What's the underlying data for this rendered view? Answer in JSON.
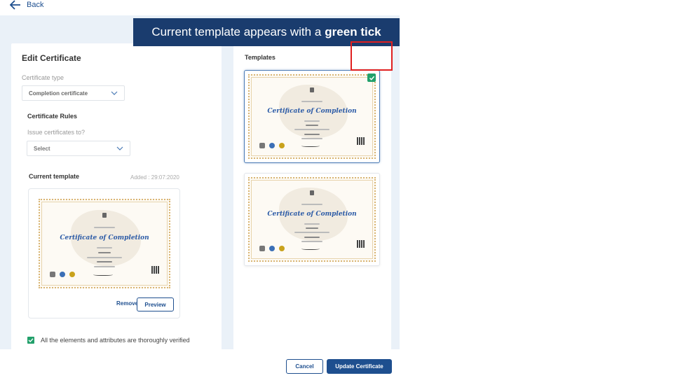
{
  "nav": {
    "back_label": "Back"
  },
  "banner": {
    "text": "Current template appears with a",
    "emphasis": "green tick"
  },
  "edit": {
    "title": "Edit Certificate",
    "type_label": "Certificate type",
    "type_value": "Completion certificate",
    "rules_title": "Certificate Rules",
    "issue_label": "Issue certificates to?",
    "issue_placeholder": "Select",
    "current_template_title": "Current template",
    "added_text": "Added : 29:07:2020",
    "remove_label": "Remove",
    "preview_label": "Preview",
    "verify_text": "All the elements and attributes are thoroughly verified",
    "verify_checked": true
  },
  "templates": {
    "title": "Templates",
    "items": [
      {
        "selected": true
      },
      {
        "selected": false
      }
    ]
  },
  "certificate_preview": {
    "heading": "Certificate of Completion"
  },
  "footer": {
    "cancel_label": "Cancel",
    "update_label": "Update Certificate"
  },
  "colors": {
    "primary": "#1e4f8f",
    "banner_bg": "#1a3c6e",
    "tick": "#22a06b",
    "highlight": "#e02020",
    "canvas": "#eaf1f8"
  }
}
